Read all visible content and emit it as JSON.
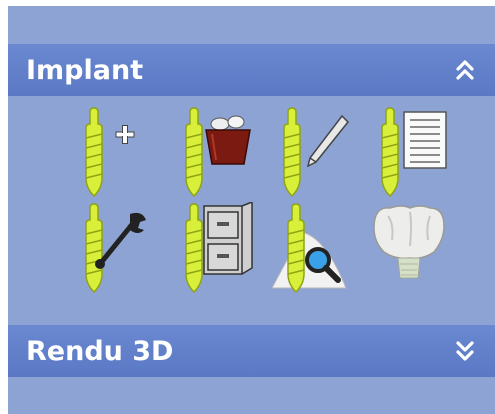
{
  "sections": [
    {
      "title": "Implant",
      "state": "expanded",
      "icon": "chevron-double-up-icon"
    },
    {
      "title": "Rendu 3D",
      "state": "collapsed",
      "icon": "chevron-double-down-icon"
    }
  ],
  "tools": [
    {
      "name": "add-implant-button",
      "icon": "implant-plus-icon"
    },
    {
      "name": "delete-implant-button",
      "icon": "implant-trash-icon"
    },
    {
      "name": "edit-implant-button",
      "icon": "implant-pencil-icon"
    },
    {
      "name": "implant-list-button",
      "icon": "implant-list-icon"
    },
    {
      "name": "implant-settings-button",
      "icon": "implant-wrench-icon"
    },
    {
      "name": "implant-library-button",
      "icon": "implant-cabinet-icon"
    },
    {
      "name": "implant-inspect-button",
      "icon": "implant-magnifier-icon"
    },
    {
      "name": "crown-button",
      "icon": "crown-icon"
    }
  ],
  "colors": {
    "panel_bg": "#8da3d3",
    "header_bg": "#5a78c4",
    "implant_yellow": "#d8f03a",
    "implant_outline": "#8fa414"
  }
}
